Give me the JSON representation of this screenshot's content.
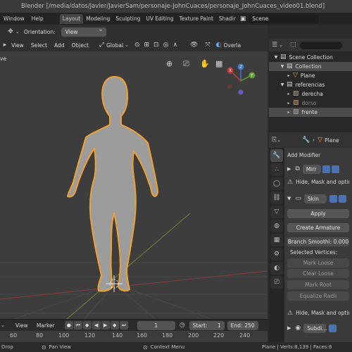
{
  "window": {
    "title": "Blender [/media/datos/Javier/JavierSam/personaje-JohnCuaces/personaje_JohnCuaces_video01.blend]"
  },
  "menubar": {
    "items": [
      "Window",
      "Help"
    ],
    "tabs": [
      "Layout",
      "Modeling",
      "Sculpting",
      "UV Editing",
      "Texture Paint",
      "Shading"
    ],
    "active_tab": "Layout",
    "scene": "Scene"
  },
  "toolbar": {
    "orientation_label": "Orientation:",
    "orientation_value": "View"
  },
  "viewport_header": {
    "menu": [
      "View",
      "Select",
      "Add",
      "Object"
    ],
    "transform": "Global",
    "overlays": "Overla"
  },
  "viewport": {
    "corner_label": "ve",
    "gizmo_axes": [
      "Z",
      "Y",
      "X"
    ]
  },
  "outliner": {
    "rows": [
      {
        "label": "Scene Collection",
        "indent": 0,
        "icon": "collection-icon",
        "selected": false,
        "dim": false
      },
      {
        "label": "Collection",
        "indent": 1,
        "icon": "collection-icon",
        "selected": true,
        "dim": false
      },
      {
        "label": "Plane",
        "indent": 2,
        "icon": "mesh-icon",
        "selected": false,
        "dim": false
      },
      {
        "label": "referencias",
        "indent": 1,
        "icon": "collection-icon",
        "selected": false,
        "dim": false
      },
      {
        "label": "derecha",
        "indent": 2,
        "icon": "image-icon",
        "selected": false,
        "dim": false
      },
      {
        "label": "dorso",
        "indent": 2,
        "icon": "image-icon",
        "selected": false,
        "dim": true
      },
      {
        "label": "frente",
        "indent": 2,
        "icon": "image-icon",
        "selected": true,
        "dim": false
      }
    ]
  },
  "properties": {
    "object_name": "Plane",
    "add_modifier": "Add Modifier",
    "modifiers": [
      {
        "name": "Mirr",
        "warning": "Hide, Mask and optimi"
      },
      {
        "name": "Skin"
      }
    ],
    "apply": "Apply",
    "create_armature": "Create Armature",
    "branch_smoothing": "Branch Smoothi: 0.000",
    "selected_vertices": "Selected Vertices:",
    "mark_loose": "Mark Loose",
    "clear_loose": "Clear Loose",
    "mark_root": "Mark Root",
    "equalize_radii": "Equalize Radii",
    "warning2": "Hide, Mask and optimi",
    "subdiv": "Subdi..."
  },
  "timeline": {
    "menu": [
      "View",
      "Marker"
    ],
    "current_frame": "1",
    "start": "Start:",
    "start_value": "1",
    "end": "End:",
    "end_value": "250"
  },
  "ruler": {
    "ticks": [
      "60",
      "80",
      "100",
      "120",
      "140",
      "160",
      "180",
      "200",
      "220",
      "240"
    ]
  },
  "status": {
    "left": "Drop",
    "pan": "Pan View",
    "context": "Context Menu",
    "stats": "Plane | Verts:8,139 | Faces:8"
  }
}
